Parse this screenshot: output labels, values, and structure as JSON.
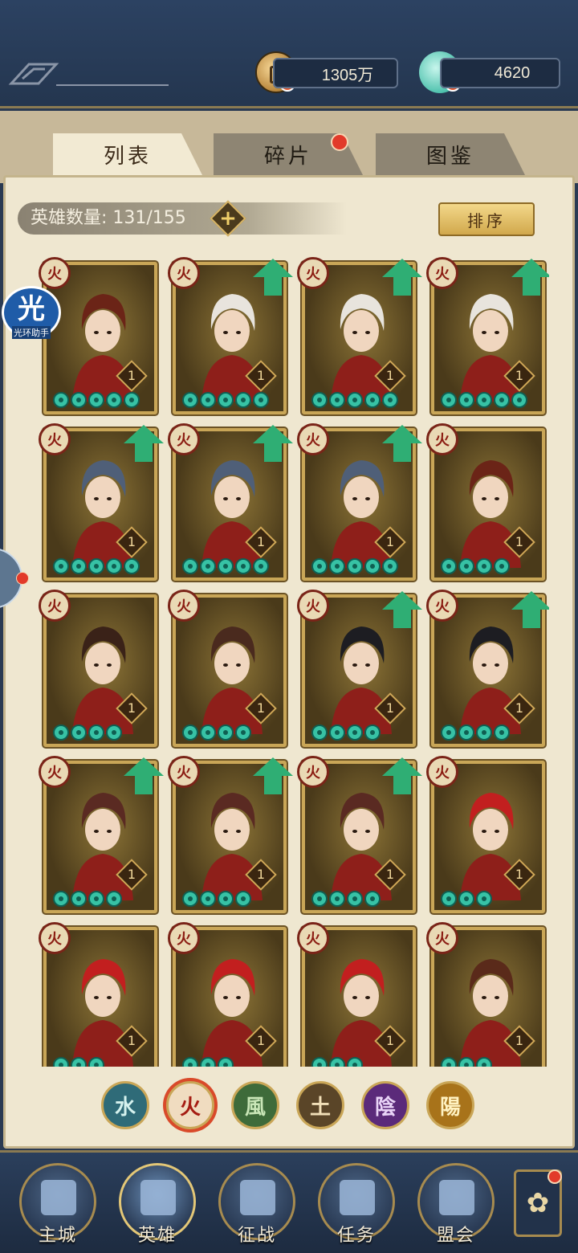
{
  "resources": {
    "coin": "1305万",
    "jade": "4620"
  },
  "tabs": [
    {
      "label": "列表",
      "active": true
    },
    {
      "label": "碎片",
      "badge": true
    },
    {
      "label": "图鉴"
    }
  ],
  "hero_count": "英雄数量: 131/155",
  "sort_label": "排序",
  "helper_app": {
    "icon_text": "光",
    "label": "光环助手"
  },
  "heroes": [
    {
      "element": "火",
      "level": "1",
      "stars": 5,
      "upgrade": false,
      "appearance": "red-haired warrior"
    },
    {
      "element": "火",
      "level": "1",
      "stars": 5,
      "upgrade": true,
      "appearance": "white-haired man"
    },
    {
      "element": "火",
      "level": "1",
      "stars": 5,
      "upgrade": true,
      "appearance": "white-haired man"
    },
    {
      "element": "火",
      "level": "1",
      "stars": 5,
      "upgrade": true,
      "appearance": "white-haired man"
    },
    {
      "element": "火",
      "level": "1",
      "stars": 5,
      "upgrade": true,
      "appearance": "bearded masked general"
    },
    {
      "element": "火",
      "level": "1",
      "stars": 5,
      "upgrade": true,
      "appearance": "bearded masked general"
    },
    {
      "element": "火",
      "level": "1",
      "stars": 5,
      "upgrade": true,
      "appearance": "bearded masked general"
    },
    {
      "element": "火",
      "level": "1",
      "stars": 4,
      "upgrade": false,
      "appearance": "red-haired warrior"
    },
    {
      "element": "火",
      "level": "1",
      "stars": 4,
      "upgrade": false,
      "appearance": "masked assassin"
    },
    {
      "element": "火",
      "level": "1",
      "stars": 4,
      "upgrade": false,
      "appearance": "ponytail swordswoman"
    },
    {
      "element": "火",
      "level": "1",
      "stars": 4,
      "upgrade": true,
      "appearance": "black-haired youth"
    },
    {
      "element": "火",
      "level": "1",
      "stars": 4,
      "upgrade": true,
      "appearance": "black-haired youth"
    },
    {
      "element": "火",
      "level": "1",
      "stars": 4,
      "upgrade": true,
      "appearance": "crowned dancer"
    },
    {
      "element": "火",
      "level": "1",
      "stars": 4,
      "upgrade": true,
      "appearance": "crowned dancer"
    },
    {
      "element": "火",
      "level": "1",
      "stars": 4,
      "upgrade": true,
      "appearance": "crowned dancer"
    },
    {
      "element": "火",
      "level": "1",
      "stars": 3,
      "upgrade": false,
      "appearance": "red-haired demon"
    },
    {
      "element": "火",
      "level": "1",
      "stars": 3,
      "upgrade": false,
      "appearance": "red-haired demon"
    },
    {
      "element": "火",
      "level": "1",
      "stars": 3,
      "upgrade": false,
      "appearance": "red-haired demon"
    },
    {
      "element": "火",
      "level": "1",
      "stars": 3,
      "upgrade": false,
      "appearance": "red-haired demon"
    },
    {
      "element": "火",
      "level": "1",
      "stars": 3,
      "upgrade": false,
      "appearance": "girl with glasses"
    }
  ],
  "element_filters": [
    {
      "label": "水",
      "color": "#2f6b78",
      "text_color": "#d6f2ee",
      "active": false
    },
    {
      "label": "火",
      "color": "#f0dcc0",
      "text_color": "#a51c12",
      "active": true
    },
    {
      "label": "風",
      "color": "#3e6b3a",
      "text_color": "#c9e6b7",
      "active": false
    },
    {
      "label": "土",
      "color": "#5a4528",
      "text_color": "#f1dfb8",
      "active": false
    },
    {
      "label": "陰",
      "color": "#5b2a7a",
      "text_color": "#e9d3f7",
      "active": false
    },
    {
      "label": "陽",
      "color": "#a8731a",
      "text_color": "#fff2c2",
      "active": false
    }
  ],
  "nav": [
    {
      "label": "主城",
      "active": false
    },
    {
      "label": "英雄",
      "active": true
    },
    {
      "label": "征战",
      "active": false
    },
    {
      "label": "任务",
      "active": false
    },
    {
      "label": "盟会",
      "active": false
    }
  ],
  "more_icon": "✿"
}
